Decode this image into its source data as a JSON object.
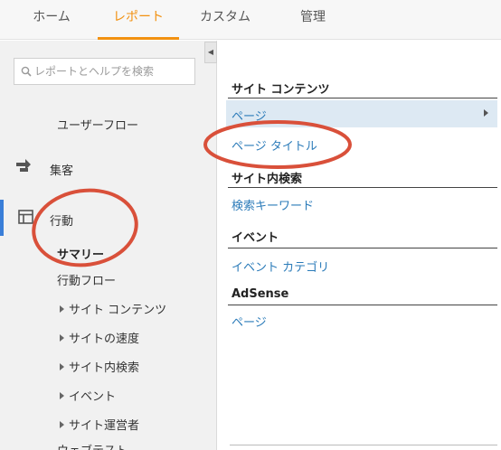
{
  "topnav": {
    "tabs": [
      {
        "label": "ホーム"
      },
      {
        "label": "レポート",
        "active": true
      },
      {
        "label": "カスタム"
      },
      {
        "label": "管理"
      }
    ],
    "accent_color": "#f29110"
  },
  "sidebar": {
    "search_placeholder": "レポートとヘルプを検索",
    "user_flow": "ユーザーフロー",
    "acquisition": "集客",
    "behavior": "行動",
    "summary": "サマリー",
    "behavior_flow": "行動フロー",
    "sub_items": [
      {
        "label": "サイト コンテンツ"
      },
      {
        "label": "サイトの速度"
      },
      {
        "label": "サイト内検索"
      },
      {
        "label": "イベント"
      },
      {
        "label": "サイト運営者"
      }
    ],
    "partial_item": "ウェブテスト",
    "active_color": "#3a7ed8",
    "icons": [
      "acquisition-arrows-icon",
      "behavior-layout-icon",
      "search-icon",
      "collapse-left-icon"
    ]
  },
  "main": {
    "site_content": {
      "title": "サイト コンテンツ",
      "links": [
        "ページ",
        "ページ タイトル"
      ]
    },
    "site_search": {
      "title": "サイト内検索",
      "links": [
        "検索キーワード"
      ]
    },
    "events": {
      "title": "イベント",
      "links": [
        "イベント カテゴリ"
      ]
    },
    "adsense": {
      "title": "AdSense",
      "links": [
        "ページ"
      ]
    },
    "link_color": "#2b7bb9",
    "highlight_color": "#dde9f3"
  },
  "annotation_color": "#d9503a"
}
